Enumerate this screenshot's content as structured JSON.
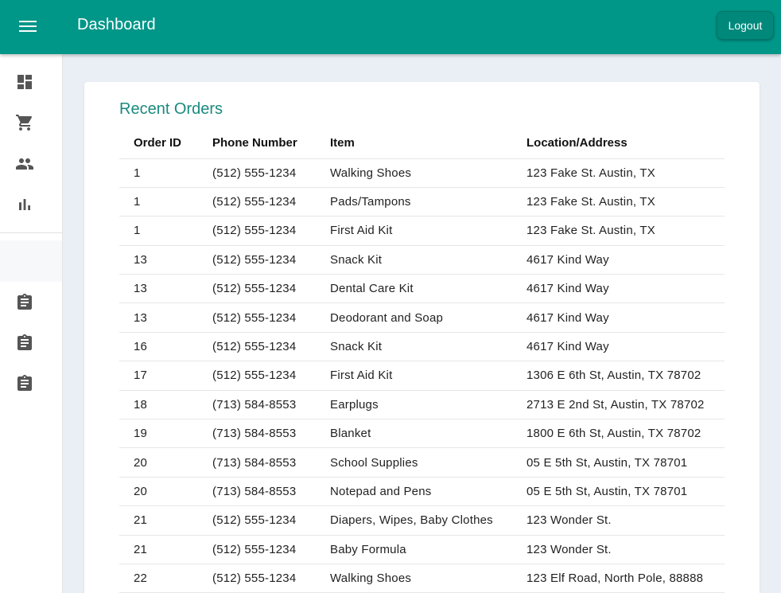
{
  "appbar": {
    "title": "Dashboard",
    "logout_label": "Logout",
    "color": "#009688"
  },
  "sidebar": {
    "items": [
      {
        "icon": "dashboard-icon"
      },
      {
        "icon": "shopping-cart-icon"
      },
      {
        "icon": "people-icon"
      },
      {
        "icon": "bar-chart-icon"
      },
      {
        "icon": "assignment-icon"
      },
      {
        "icon": "assignment-icon"
      },
      {
        "icon": "assignment-icon"
      }
    ]
  },
  "orders": {
    "title": "Recent Orders",
    "columns": [
      "Order ID",
      "Phone Number",
      "Item",
      "Location/Address"
    ],
    "rows": [
      [
        "1",
        "(512) 555-1234",
        "Walking Shoes",
        "123 Fake St. Austin, TX"
      ],
      [
        "1",
        "(512) 555-1234",
        "Pads/Tampons",
        "123 Fake St. Austin, TX"
      ],
      [
        "1",
        "(512) 555-1234",
        "First Aid Kit",
        "123 Fake St. Austin, TX"
      ],
      [
        "13",
        "(512) 555-1234",
        "Snack Kit",
        "4617 Kind Way"
      ],
      [
        "13",
        "(512) 555-1234",
        "Dental Care Kit",
        "4617 Kind Way"
      ],
      [
        "13",
        "(512) 555-1234",
        "Deodorant and Soap",
        "4617 Kind Way"
      ],
      [
        "16",
        "(512) 555-1234",
        "Snack Kit",
        "4617 Kind Way"
      ],
      [
        "17",
        "(512) 555-1234",
        "First Aid Kit",
        "1306 E 6th St, Austin, TX 78702"
      ],
      [
        "18",
        "(713) 584-8553",
        "Earplugs",
        "2713 E 2nd St, Austin, TX 78702"
      ],
      [
        "19",
        "(713) 584-8553",
        "Blanket",
        "1800 E 6th St, Austin, TX 78702"
      ],
      [
        "20",
        "(713) 584-8553",
        "School Supplies",
        "05 E 5th St, Austin, TX 78701"
      ],
      [
        "20",
        "(713) 584-8553",
        "Notepad and Pens",
        "05 E 5th St, Austin, TX 78701"
      ],
      [
        "21",
        "(512) 555-1234",
        "Diapers, Wipes, Baby Clothes",
        "123 Wonder St."
      ],
      [
        "21",
        "(512) 555-1234",
        "Baby Formula",
        "123 Wonder St."
      ],
      [
        "22",
        "(512) 555-1234",
        "Walking Shoes",
        "123 Elf Road, North Pole, 88888"
      ]
    ]
  }
}
